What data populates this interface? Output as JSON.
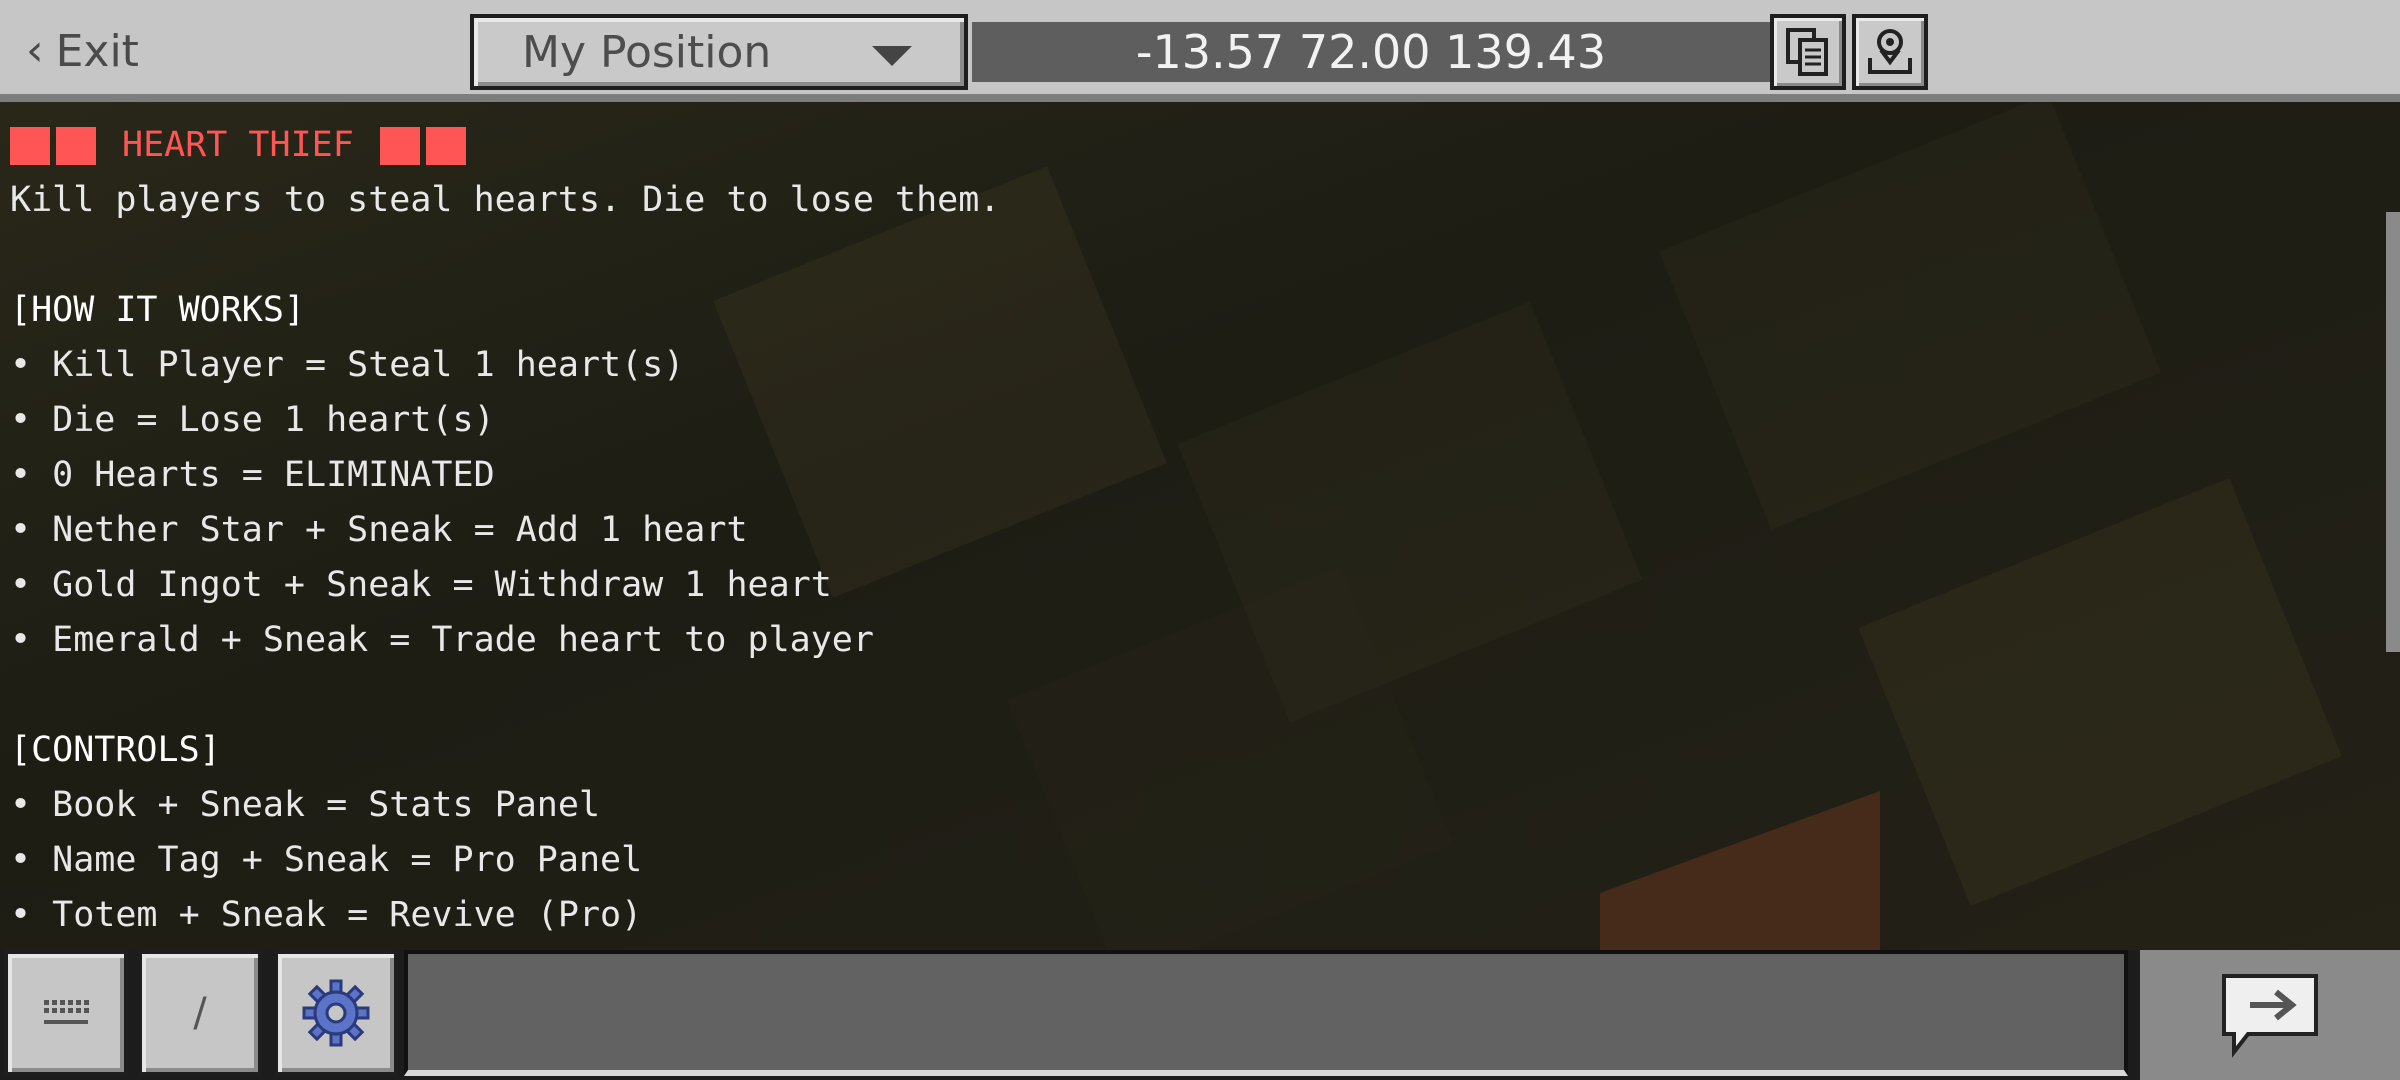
{
  "topbar": {
    "exit_label": "Exit",
    "position_dropdown": {
      "selected": "My Position"
    },
    "coordinates": "-13.57 72.00 139.43",
    "copy_icon": "copy-coordinates-icon",
    "share_icon": "share-location-icon"
  },
  "chat": {
    "title": "HEART THIEF",
    "title_color": "#ff5555",
    "subtitle": "Kill players to steal hearts. Die to lose them.",
    "how_header": "[HOW IT WORKS]",
    "how_items": [
      "• Kill Player = Steal 1 heart(s)",
      "• Die = Lose 1 heart(s)",
      "• 0 Hearts = ELIMINATED",
      "• Nether Star + Sneak = Add 1 heart",
      "• Gold Ingot + Sneak = Withdraw 1 heart",
      "• Emerald + Sneak = Trade heart to player"
    ],
    "controls_header": "[CONTROLS]",
    "controls_items": [
      "• Book + Sneak = Stats Panel",
      "• Name Tag + Sneak = Pro Panel",
      "• Totem + Sneak = Revive (Pro)"
    ]
  },
  "bottombar": {
    "keyboard_icon": "keyboard-icon",
    "slash_label": "/",
    "settings_icon": "gear-icon",
    "chat_input_value": "",
    "send_icon": "send-message-icon"
  }
}
